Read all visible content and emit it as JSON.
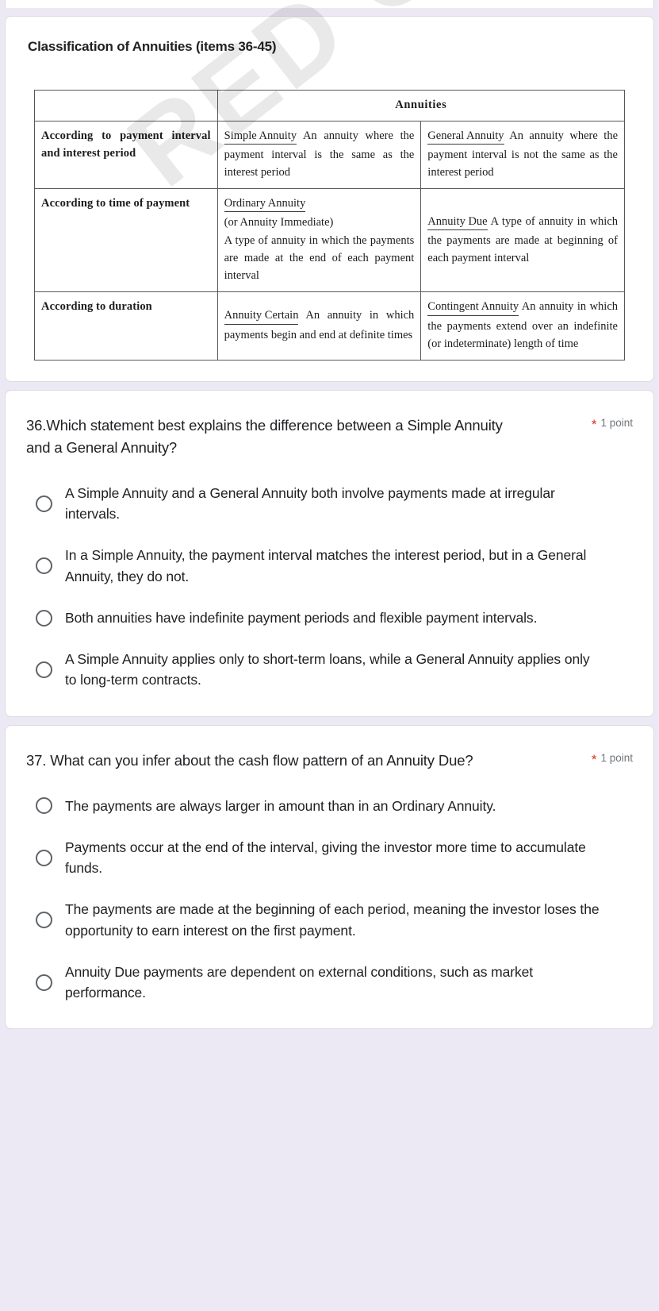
{
  "theme": {
    "page_background": "#ece9f4",
    "card_background": "#ffffff",
    "card_border": "#dadce0",
    "required_star_color": "#d93025",
    "points_text_color": "#70757a",
    "radio_border_color": "#5f6368",
    "text_color": "#202124"
  },
  "image_card": {
    "title": "Classification of Annuities (items 36-45)",
    "watermark": "RED COPY",
    "table": {
      "corner_blank": "",
      "top_header": "Annuities",
      "rows": [
        {
          "category": "According to payment interval and interest period",
          "left": {
            "term": "Simple Annuity",
            "subterm": "",
            "definition": "An annuity where the payment interval is the same as the interest period"
          },
          "right": {
            "term": "General Annuity",
            "subterm": "",
            "definition": "An annuity where the payment interval is not the same as the interest period"
          }
        },
        {
          "category": "According to time of payment",
          "left": {
            "term": "Ordinary Annuity",
            "subterm": "(or Annuity Immediate)",
            "definition": "A type of annuity in which the payments are made at the end of each payment interval"
          },
          "right": {
            "term": "Annuity Due",
            "subterm": "",
            "definition": "A type of annuity in which the payments are made at beginning of each payment interval"
          }
        },
        {
          "category": "According to duration",
          "left": {
            "term": "Annuity Certain",
            "subterm": "",
            "definition": "An annuity in which payments begin and end at definite times"
          },
          "right": {
            "term": "Contingent Annuity",
            "subterm": "",
            "definition": "An annuity in which the payments extend over an indefinite (or indeterminate) length of time"
          }
        }
      ]
    }
  },
  "questions": [
    {
      "text": "36.Which statement best explains the difference between a Simple Annuity and a General Annuity?",
      "required_marker": "*",
      "points": "1 point",
      "options": [
        "A Simple Annuity and a General Annuity both involve payments made at irregular intervals.",
        "In a Simple Annuity, the payment interval matches the interest period, but in a General Annuity, they do not.",
        "Both annuities have indefinite payment periods and flexible payment intervals.",
        "A Simple Annuity applies only to short-term loans, while a General Annuity applies only to long-term contracts."
      ]
    },
    {
      "text": "37.  What can you infer about the cash flow pattern of an Annuity Due?",
      "required_marker": "*",
      "points": "1 point",
      "options": [
        "The payments are always larger in amount than in an Ordinary Annuity.",
        "Payments occur at the end of the interval, giving the investor more time to accumulate funds.",
        "The payments are made at the beginning of each period, meaning the investor loses the opportunity to earn interest on the first payment.",
        "Annuity Due payments are dependent on external conditions, such as market performance."
      ]
    }
  ]
}
